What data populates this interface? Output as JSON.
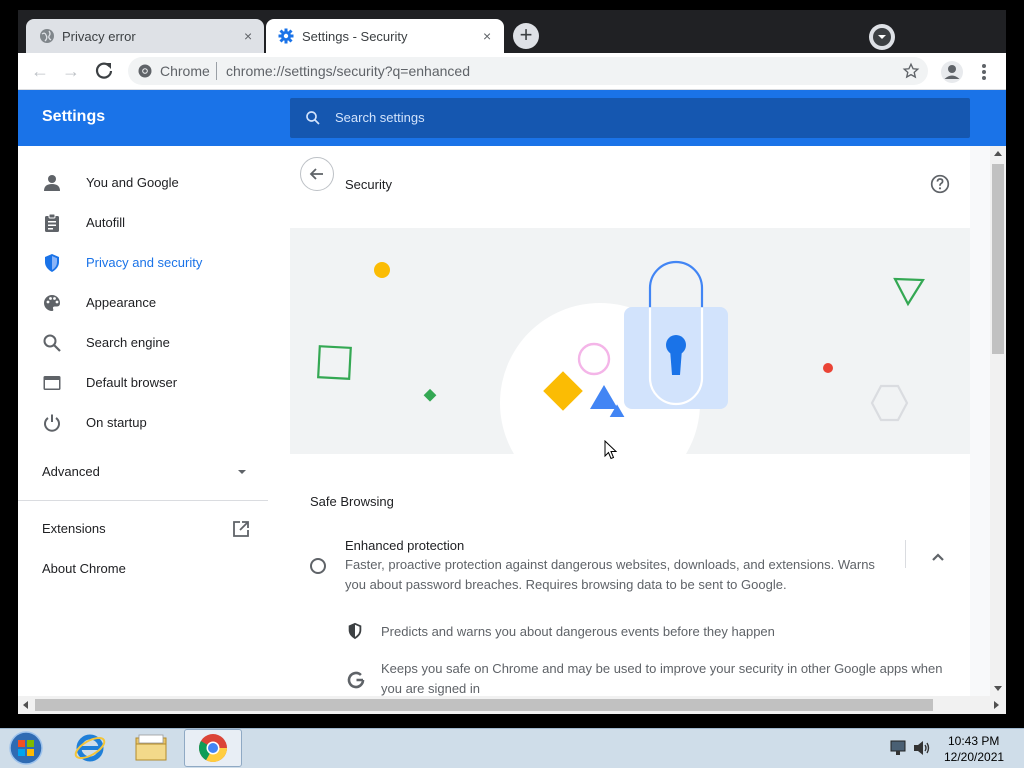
{
  "tabs": [
    {
      "title": "Privacy error",
      "close": "×"
    },
    {
      "title": "Settings - Security",
      "close": "×"
    }
  ],
  "toolbar": {
    "site_label": "Chrome",
    "url": "chrome://settings/security?q=enhanced"
  },
  "settings_header": {
    "title": "Settings",
    "search_placeholder": "Search settings"
  },
  "sidebar": {
    "items": [
      {
        "label": "You and Google",
        "icon": "person-icon"
      },
      {
        "label": "Autofill",
        "icon": "clipboard-icon"
      },
      {
        "label": "Privacy and security",
        "icon": "shield-icon"
      },
      {
        "label": "Appearance",
        "icon": "palette-icon"
      },
      {
        "label": "Search engine",
        "icon": "search-icon"
      },
      {
        "label": "Default browser",
        "icon": "browser-icon"
      },
      {
        "label": "On startup",
        "icon": "power-icon"
      }
    ],
    "advanced": "Advanced",
    "extensions": "Extensions",
    "about": "About Chrome"
  },
  "page": {
    "title": "Security",
    "section_title": "Safe Browsing",
    "enhanced": {
      "title": "Enhanced protection",
      "description": "Faster, proactive protection against dangerous websites, downloads, and extensions. Warns you about password breaches. Requires browsing data to be sent to Google."
    },
    "details": [
      {
        "text": "Predicts and warns you about dangerous events before they happen",
        "icon": "shield-icon"
      },
      {
        "text": "Keeps you safe on Chrome and may be used to improve your security in other Google apps when you are signed in",
        "icon": "google-g-icon"
      }
    ]
  },
  "taskbar": {
    "time": "10:43 PM",
    "date": "12/20/2021"
  },
  "colors": {
    "accent": "#1a73e8",
    "header_blue": "#1a73e8",
    "search_blue": "#1557b0"
  }
}
